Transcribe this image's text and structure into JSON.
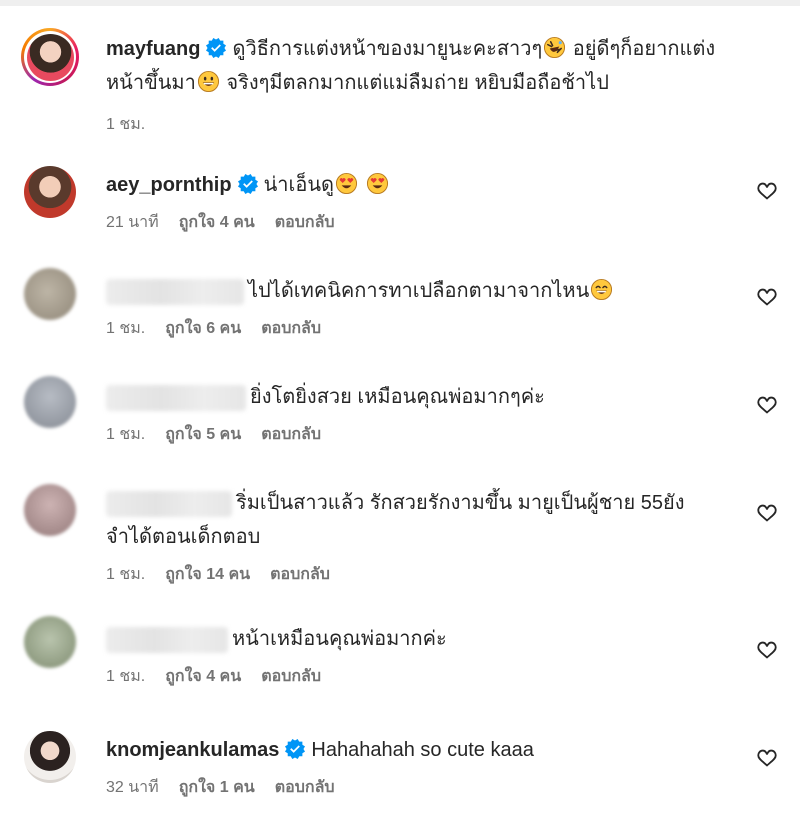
{
  "post": {
    "username": "mayfuang",
    "caption_line1_a": "ดูวิธีการแต่งหน้าของมายูนะคะสาวๆ",
    "caption_line1_b": "อยู่ดีๆก็อยากแต่ง",
    "caption_line2_a": "หน้าขึ้นมา",
    "caption_line2_b": "จริงๆมีตลกมากแต่แม่ลืมถ่าย หยิบมือถือช้าไป",
    "time": "1 ชม."
  },
  "comments": [
    {
      "username": "aey_pornthip",
      "verified": true,
      "text": "น่าเอ็นดู",
      "time": "21 นาที",
      "likes": "ถูกใจ 4 คน",
      "reply": "ตอบกลับ",
      "avatar_color": "#c9a08a"
    },
    {
      "username": "",
      "verified": false,
      "text": "ไปได้เทคนิคการทาเปลือกตามาจากไหน",
      "time": "1 ชม.",
      "likes": "ถูกใจ 6 คน",
      "reply": "ตอบกลับ",
      "avatar_color": "#a8a093"
    },
    {
      "username": "",
      "verified": false,
      "text": "ยิ่งโตยิ่งสวย เหมือนคุณพ่อมากๆค่ะ",
      "time": "1 ชม.",
      "likes": "ถูกใจ 5 คน",
      "reply": "ตอบกลับ",
      "avatar_color": "#9ea3ad"
    },
    {
      "username": "",
      "verified": false,
      "text_line1": "ริ่มเป็นสาวแล้ว รักสวยรักงามขึ้น มายูเป็นผู้ชาย 55ยัง",
      "text_line2": "จำได้ตอนเด็กตอบ",
      "time": "1 ชม.",
      "likes": "ถูกใจ 14 คน",
      "reply": "ตอบกลับ",
      "avatar_color": "#b79e9e"
    },
    {
      "username": "",
      "verified": false,
      "text": "หน้าเหมือนคุณพ่อมากค่ะ",
      "time": "1 ชม.",
      "likes": "ถูกใจ 4 คน",
      "reply": "ตอบกลับ",
      "avatar_color": "#a6b29a"
    },
    {
      "username": "knomjeankulamas",
      "verified": true,
      "text": "Hahahahah so cute kaaa",
      "time": "32 นาที",
      "likes": "ถูกใจ 1 คน",
      "reply": "ตอบกลับ",
      "avatar_color": "#e8e4e0"
    }
  ],
  "icons": {
    "verified": "verified-badge-icon",
    "like": "heart-outline-icon"
  },
  "colors": {
    "verified": "#0095f6",
    "meta_text": "#737373",
    "primary_text": "#262626"
  }
}
